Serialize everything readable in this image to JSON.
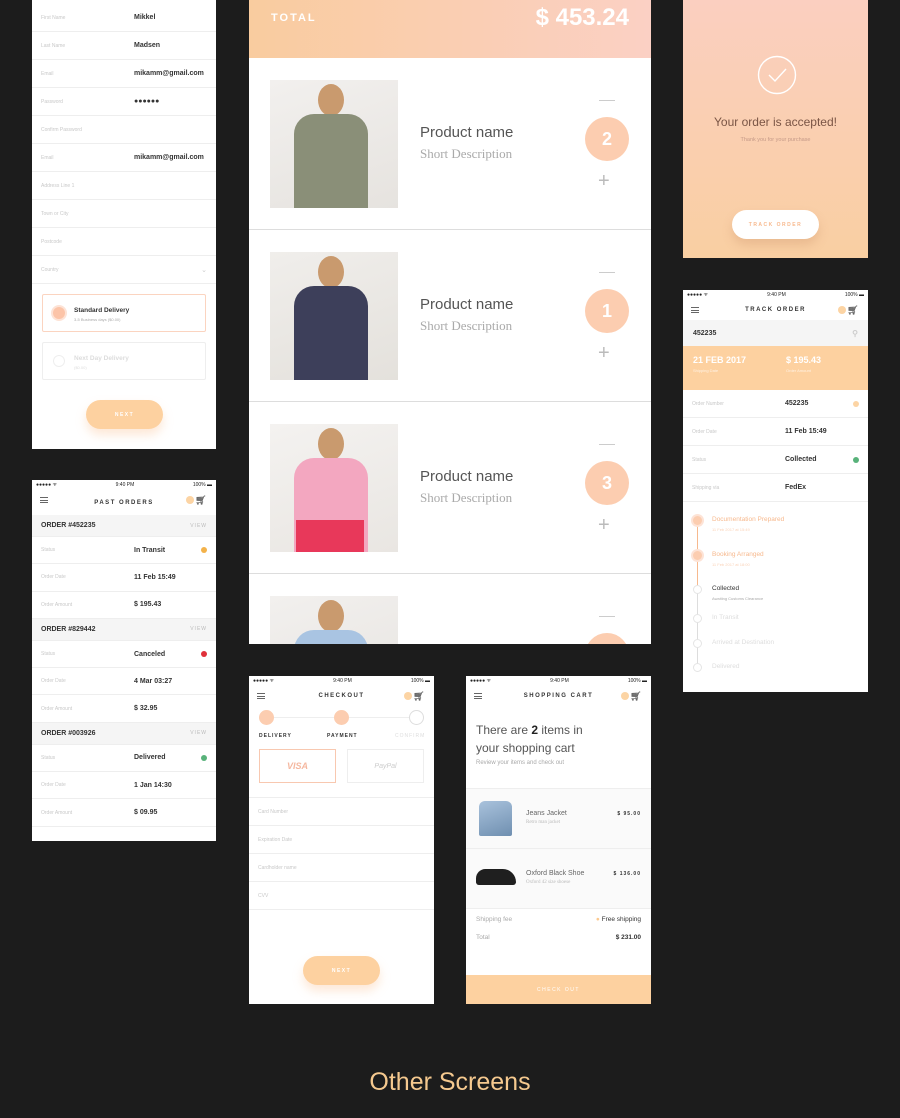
{
  "colors": {
    "accent": "#fdd1a0",
    "peach": "#fccdb0",
    "in_transit": "#f3b24a",
    "canceled": "#e0303a",
    "delivered": "#58b27a",
    "background": "#1c1c1c"
  },
  "status_bar": {
    "carrier": "●●●●● ᯤ",
    "time": "9:40 PM",
    "battery": "100% ▬"
  },
  "form": {
    "rows": [
      {
        "label": "First Name",
        "value": "Mikkel"
      },
      {
        "label": "Last Name",
        "value": "Madsen"
      },
      {
        "label": "Email",
        "value": "mikamm@gmail.com"
      },
      {
        "label": "Password",
        "value": "●●●●●●"
      },
      {
        "label": "Confirm Password",
        "value": ""
      },
      {
        "label": "Email",
        "value": "mikamm@gmail.com"
      },
      {
        "label": "Address Line 1",
        "value": ""
      },
      {
        "label": "Town or City",
        "value": ""
      },
      {
        "label": "Postcode",
        "value": ""
      },
      {
        "label": "Country",
        "value": ""
      }
    ],
    "delivery": [
      {
        "title": "Standard Delivery",
        "sub": "3-5 Business days ($0.00)",
        "selected": true
      },
      {
        "title": "Next Day Delivery",
        "sub": "($0.00)",
        "selected": false
      }
    ],
    "next": "NEXT"
  },
  "cart_big": {
    "total_label": "TOTAL",
    "total": "$ 453.24",
    "items": [
      {
        "name": "Product name",
        "desc": "Short Description",
        "qty": "2"
      },
      {
        "name": "Product name",
        "desc": "Short Description",
        "qty": "1"
      },
      {
        "name": "Product name",
        "desc": "Short Description",
        "qty": "3"
      },
      {
        "name": "",
        "desc": "",
        "qty": ""
      }
    ]
  },
  "accepted": {
    "title": "Your order is accepted!",
    "sub": "Thank you for your purchase",
    "button": "TRACK ORDER",
    "icon": "check-circle-icon"
  },
  "track": {
    "title": "TRACK ORDER",
    "search": "452235",
    "band": [
      {
        "value": "21 FEB 2017",
        "label": "Shipping Date"
      },
      {
        "value": "$ 195.43",
        "label": "Order Amount"
      }
    ],
    "rows": [
      {
        "label": "Order Number",
        "value": "452235",
        "dot": "#fcd4a4"
      },
      {
        "label": "Order Date",
        "value": "11 Feb 15:49",
        "dot": ""
      },
      {
        "label": "Status",
        "value": "Collected",
        "dot": "#58b27a"
      },
      {
        "label": "Shipping via",
        "value": "FedEx",
        "dot": ""
      }
    ],
    "steps": [
      {
        "title": "Documentation Prepared",
        "sub": "11 Feb 2017 at 15:49",
        "state": "done"
      },
      {
        "title": "Booking Arranged",
        "sub": "11 Feb 2017 at 18:00",
        "state": "done"
      },
      {
        "title": "Collected",
        "sub": "Awaiting Customs Clearance",
        "state": "current"
      },
      {
        "title": "In Transit",
        "sub": "",
        "state": "todo"
      },
      {
        "title": "Arrived at Destination",
        "sub": "",
        "state": "todo"
      },
      {
        "title": "Delivered",
        "sub": "",
        "state": "todo"
      }
    ]
  },
  "past": {
    "title": "PAST ORDERS",
    "view": "VIEW",
    "orders": [
      {
        "id": "ORDER #452235",
        "status": "In Transit",
        "dot": "#f3b24a",
        "date": "11 Feb 15:49",
        "amount": "$ 195.43"
      },
      {
        "id": "ORDER #829442",
        "status": "Canceled",
        "dot": "#e0303a",
        "date": "4 Mar 03:27",
        "amount": "$ 32.95"
      },
      {
        "id": "ORDER #003926",
        "status": "Delivered",
        "dot": "#58b27a",
        "date": "1 Jan 14:30",
        "amount": "$ 09.95"
      }
    ],
    "labels": {
      "status": "Status",
      "date": "Order Date",
      "amount": "Order Amount"
    }
  },
  "checkout": {
    "title": "CHECKOUT",
    "steps": [
      "DELIVERY",
      "PAYMENT",
      "CONFIRM"
    ],
    "methods": [
      "VISA",
      "PayPal"
    ],
    "fields": [
      "Card Number",
      "Expiration Date",
      "Cardholder name",
      "CVV"
    ],
    "next": "NEXT"
  },
  "shop": {
    "title": "SHOPPING CART",
    "headline_pre": "There are ",
    "count": "2",
    "headline_post": " items in",
    "headline2": "your shopping cart",
    "sub": "Review your items and check out",
    "items": [
      {
        "name": "Jeans Jacket",
        "desc": "Retro man jacket",
        "price": "$ 95.00"
      },
      {
        "name": "Oxford Black Shoe",
        "desc": "Oxford 42 size shoese",
        "price": "$ 136.00"
      }
    ],
    "shipping_label": "Shipping fee",
    "shipping_value": "Free shipping",
    "total_label": "Total",
    "total": "$ 231.00",
    "checkout": "CHECK OUT"
  },
  "footer": {
    "title": "Other Screens"
  }
}
